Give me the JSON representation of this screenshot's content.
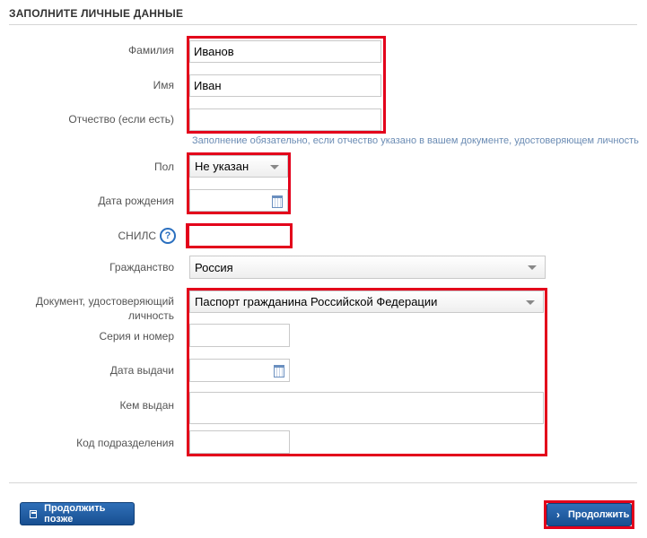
{
  "form": {
    "title": "ЗАПОЛНИТЕ ЛИЧНЫЕ ДАННЫЕ",
    "surname": {
      "label": "Фамилия",
      "value": "Иванов"
    },
    "name": {
      "label": "Имя",
      "value": "Иван"
    },
    "patronymic": {
      "label": "Отчество (если есть)",
      "value": ""
    },
    "patronymic_hint": "Заполнение обязательно, если отчество указано в вашем документе, удостоверяющем личность",
    "gender": {
      "label": "Пол",
      "value": "Не указан"
    },
    "birth_date": {
      "label": "Дата рождения",
      "value": ""
    },
    "snils": {
      "label": "СНИЛС",
      "help": "?",
      "value": ""
    },
    "citizenship": {
      "label": "Гражданство",
      "value": "Россия"
    },
    "document": {
      "label_line1": "Документ, удостоверяющий",
      "label_line2": "личность",
      "value": "Паспорт гражданина Российской Федерации"
    },
    "series_number": {
      "label": "Серия и номер",
      "value": ""
    },
    "issue_date": {
      "label": "Дата выдачи",
      "value": ""
    },
    "issued_by": {
      "label": "Кем выдан",
      "value": ""
    },
    "division_code": {
      "label": "Код подразделения",
      "value": ""
    }
  },
  "footer": {
    "later_label": "Продолжить позже",
    "continue_label": "Продолжить"
  },
  "colors": {
    "highlight": "#e3001b",
    "button": "#1f5fa6",
    "hint": "#6b8cb4"
  }
}
